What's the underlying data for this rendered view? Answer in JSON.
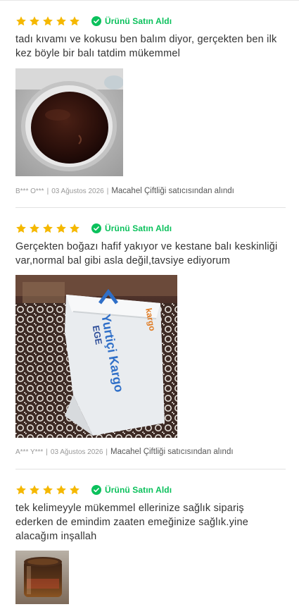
{
  "reviews": [
    {
      "rating": 5,
      "verified_label": "Ürünü Satın Aldı",
      "comment": "tadı kıvamı ve kokusu ben balım diyor, gerçekten ben ilk kez böyle bir balı tatdim mükemmel",
      "user": "B*** O***",
      "date": "03 Ağustos 2026",
      "seller": "Macahel Çiftliği satıcısından alındı"
    },
    {
      "rating": 5,
      "verified_label": "Ürünü Satın Aldı",
      "comment": "Gerçekten boğazı hafif yakıyor ve kestane balı keskinliği var,normal bal gibi asla değil,tavsiye ediyorum",
      "user": "A*** Y***",
      "date": "03 Ağustos 2026",
      "seller": "Macahel Çiftliği satıcısından alındı"
    },
    {
      "rating": 5,
      "verified_label": "Ürünü Satın Aldı",
      "comment": "tek kelimeyyle mükemmel ellerinize sağlık sipariş ederken de emindim zaaten emeğinize sağlık.yine alacağım inşallah"
    }
  ],
  "separator": "|",
  "colors": {
    "star": "#f5b800",
    "verified": "#0bc15c",
    "divider": "#e2e2e2"
  },
  "icons": {
    "star": "star-icon",
    "verified": "check-circle-icon"
  },
  "box_print": {
    "brand": "Yurtiçi Kargo",
    "region": "EGE",
    "word": "kargo"
  }
}
